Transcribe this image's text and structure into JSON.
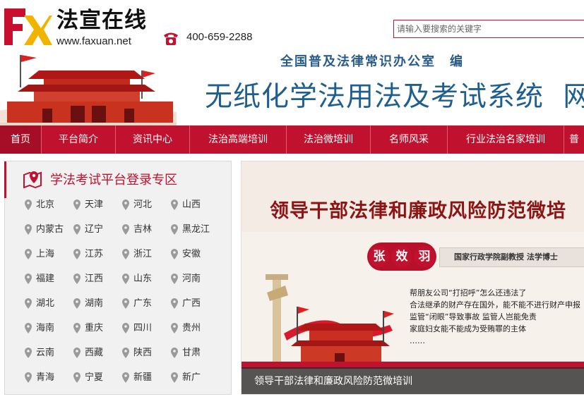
{
  "site": {
    "logo_brand": "法宣在线",
    "logo_url": "www.faxuan.net",
    "phone": "400-659-2288",
    "office": "全国普及法律常识办公室　编",
    "system_title": "无纸化学法用法及考试系统",
    "system_title_cut": "网"
  },
  "search": {
    "placeholder": "请输入要搜索的关键字"
  },
  "nav": {
    "items": [
      {
        "label": "首页"
      },
      {
        "label": "平台简介"
      },
      {
        "label": "资讯中心"
      },
      {
        "label": "法治高端培训"
      },
      {
        "label": "法治微培训"
      },
      {
        "label": "名师风采"
      },
      {
        "label": "行业法治名家培训"
      },
      {
        "label": "普"
      }
    ]
  },
  "login_panel": {
    "title": "学法考试平台登录专区",
    "regions": [
      "北京",
      "天津",
      "河北",
      "山西",
      "内蒙古",
      "辽宁",
      "吉林",
      "黑龙江",
      "上海",
      "江苏",
      "浙江",
      "安徽",
      "福建",
      "江西",
      "山东",
      "河南",
      "湖北",
      "湖南",
      "广东",
      "广西",
      "海南",
      "重庆",
      "四川",
      "贵州",
      "云南",
      "西藏",
      "陕西",
      "甘肃",
      "青海",
      "宁夏",
      "新疆",
      "新广"
    ]
  },
  "promo": {
    "title": "领导干部法律和廉政风险防范微培",
    "speaker_chars": [
      "张",
      "效",
      "羽"
    ],
    "credential": "国家行政学院副教授  法学博士",
    "bullets": [
      "帮朋友公司“打招呼”怎么还违法了",
      "合法继承的财产存在国外，能不能不进行财产申报",
      "监管“闭眼”导致事故 监管人岂能免责",
      "家庭妇女能不能成为受贿罪的主体",
      "……"
    ],
    "caption": "领导干部法律和廉政风险防范微培训"
  },
  "colors": {
    "brand_red": "#c0112f",
    "title_blue": "#1f5f8e",
    "office_blue": "#2a5c8a"
  }
}
